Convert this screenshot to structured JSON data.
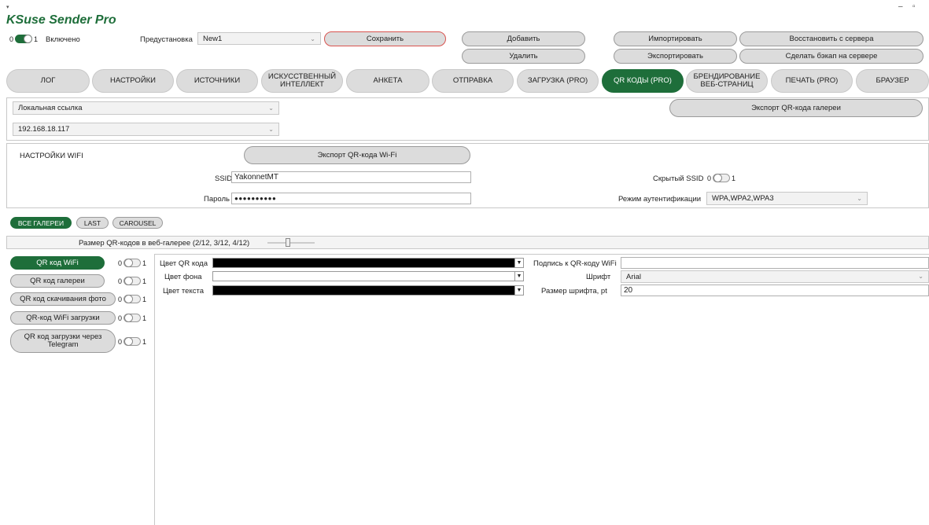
{
  "titlebar": {
    "min": "–",
    "restore": "▫",
    "icon": "app-icon"
  },
  "app": {
    "title": "KSuse Sender Pro"
  },
  "header": {
    "enabled_off": "0",
    "enabled_on": "1",
    "enabled_label": "Включено",
    "preset_label": "Предустановка",
    "preset_value": "New1",
    "save": "Сохранить",
    "add": "Добавить",
    "delete": "Удалить",
    "import": "Импортировать",
    "export": "Экспортировать",
    "restore": "Восстановить с сервера",
    "backup": "Сделать бэкап на сервере"
  },
  "tabs": [
    {
      "label": "ЛОГ"
    },
    {
      "label": "НАСТРОЙКИ"
    },
    {
      "label": "ИСТОЧНИКИ"
    },
    {
      "label": "ИСКУССТВЕННЫЙ ИНТЕЛЛЕКТ"
    },
    {
      "label": "АНКЕТА"
    },
    {
      "label": "ОТПРАВКА"
    },
    {
      "label": "ЗАГРУЗКА (PRO)"
    },
    {
      "label": "QR КОДЫ (PRO)"
    },
    {
      "label": "БРЕНДИРОВАНИЕ ВЕБ-СТРАНИЦ"
    },
    {
      "label": "ПЕЧАТЬ (PRO)"
    },
    {
      "label": "БРАУЗЕР"
    }
  ],
  "link": {
    "type_value": "Локальная ссылка",
    "ip_value": "192.168.18.117",
    "export_gallery": "Экспорт QR-кода галереи"
  },
  "wifi": {
    "title": "НАСТРОЙКИ WIFI",
    "export": "Экспорт QR-кода Wi-Fi",
    "ssid_label": "SSID",
    "ssid_value": "YakonnetMT",
    "hidden_label": "Скрытый SSID",
    "hidden_off": "0",
    "hidden_on": "1",
    "password_label": "Пароль",
    "password_value": "●●●●●●●●●●",
    "auth_label": "Режим аутентификации",
    "auth_value": "WPA,WPA2,WPA3"
  },
  "galleries": {
    "items": [
      {
        "label": "ВСЕ ГАЛЕРЕИ"
      },
      {
        "label": "LAST"
      },
      {
        "label": "CAROUSEL"
      }
    ],
    "size_label": "Размер QR-кодов в веб-галерее (2/12, 3/12, 4/12)"
  },
  "qr_list": [
    {
      "label": "QR код WiFi",
      "off": "0",
      "on": "1"
    },
    {
      "label": "QR код галереи",
      "off": "0",
      "on": "1"
    },
    {
      "label": "QR код скачивания фото",
      "off": "0",
      "on": "1"
    },
    {
      "label": "QR-код WiFi загрузки",
      "off": "0",
      "on": "1"
    },
    {
      "label": "QR код загрузки через Telegram",
      "off": "0",
      "on": "1"
    }
  ],
  "qr_settings": {
    "qr_color_label": "Цвет QR кода",
    "bg_color_label": "Цвет фона",
    "text_color_label": "Цвет текста",
    "caption_label": "Подпись к QR-коду WiFi",
    "caption_value": "",
    "font_label": "Шрифт",
    "font_value": "Arial",
    "font_size_label": "Размер шрифта, pt",
    "font_size_value": "20",
    "qr_color": "#000000",
    "bg_color": "#ffffff",
    "text_color": "#000000"
  },
  "colors": {
    "accent": "#1e6e3a",
    "brand_title": "#1e6e3a"
  }
}
